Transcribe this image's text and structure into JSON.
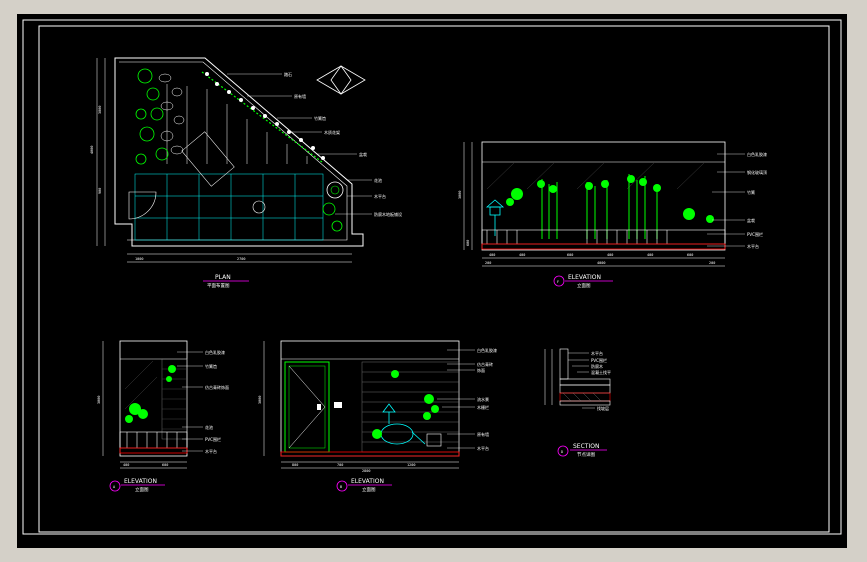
{
  "drawing": {
    "plan": {
      "title": "PLAN",
      "subtitle": "平面布置图",
      "labels": [
        "踏石",
        "原有墙",
        "竹篱笆",
        "木质花架",
        "盆栽",
        "花池",
        "木平台",
        "防腐木地板铺设"
      ],
      "dims_bottom": [
        "1000",
        "2700"
      ],
      "dims_left": [
        "4000",
        "3800",
        "900"
      ]
    },
    "elevation_main": {
      "title": "ELEVATION",
      "subtitle": "立面图",
      "marker": "F",
      "labels": [
        "白色乳胶漆",
        "钢化玻璃顶",
        "竹篱",
        "盆栽",
        "PVC围栏",
        "木平台"
      ],
      "dims_bottom": [
        "400",
        "400",
        "600",
        "400",
        "400",
        "600"
      ],
      "dims_bottom_total": [
        "200",
        "4000",
        "200"
      ],
      "dims_left": [
        "3000",
        "600"
      ]
    },
    "elevation_a": {
      "title": "ELEVATION",
      "subtitle": "立面图",
      "marker": "A",
      "labels": [
        "白色乳胶漆",
        "竹篱笆",
        "仿古青砖饰面",
        "花池",
        "PVC围栏",
        "木平台"
      ],
      "dims_bottom": [
        "400",
        "600"
      ],
      "dims_left": [
        "3000"
      ]
    },
    "elevation_b": {
      "title": "ELEVATION",
      "subtitle": "立面图",
      "marker": "B",
      "labels": [
        "白色乳胶漆",
        "仿古青砖",
        "饰面",
        "流水景",
        "木栅栏",
        "原有墙",
        "木平台"
      ],
      "dims_bottom": [
        "800",
        "700",
        "1200"
      ],
      "dims_bottom_total": [
        "2800"
      ],
      "dims_left": [
        "3000"
      ]
    },
    "section": {
      "title": "SECTION",
      "subtitle": "节点详图",
      "marker": "D",
      "labels": [
        "木平台",
        "PVC围栏",
        "防腐木",
        "混凝土找平",
        "找坡层"
      ]
    }
  }
}
